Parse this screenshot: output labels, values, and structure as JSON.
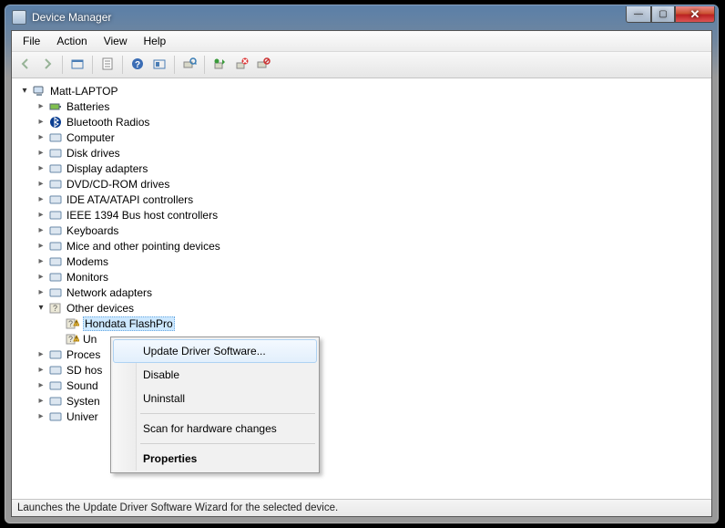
{
  "window": {
    "title": "Device Manager"
  },
  "menubar": [
    "File",
    "Action",
    "View",
    "Help"
  ],
  "toolbar_buttons": [
    {
      "name": "back",
      "enabled": false
    },
    {
      "name": "forward",
      "enabled": false
    },
    {
      "name": "sep"
    },
    {
      "name": "up-container",
      "enabled": true
    },
    {
      "name": "sep"
    },
    {
      "name": "properties-sheet",
      "enabled": true
    },
    {
      "name": "sep"
    },
    {
      "name": "help",
      "enabled": true
    },
    {
      "name": "show-hidden",
      "enabled": true
    },
    {
      "name": "sep"
    },
    {
      "name": "scan-hardware",
      "enabled": true
    },
    {
      "name": "sep"
    },
    {
      "name": "update-driver",
      "enabled": true
    },
    {
      "name": "uninstall",
      "enabled": true
    },
    {
      "name": "disable",
      "enabled": true
    }
  ],
  "tree": {
    "root": "Matt-LAPTOP",
    "children": [
      {
        "label": "Batteries",
        "icon": "battery"
      },
      {
        "label": "Bluetooth Radios",
        "icon": "bluetooth"
      },
      {
        "label": "Computer",
        "icon": "computer"
      },
      {
        "label": "Disk drives",
        "icon": "disk"
      },
      {
        "label": "Display adapters",
        "icon": "display"
      },
      {
        "label": "DVD/CD-ROM drives",
        "icon": "optical"
      },
      {
        "label": "IDE ATA/ATAPI controllers",
        "icon": "ide"
      },
      {
        "label": "IEEE 1394 Bus host controllers",
        "icon": "firewire"
      },
      {
        "label": "Keyboards",
        "icon": "keyboard"
      },
      {
        "label": "Mice and other pointing devices",
        "icon": "mouse"
      },
      {
        "label": "Modems",
        "icon": "modem"
      },
      {
        "label": "Monitors",
        "icon": "monitor"
      },
      {
        "label": "Network adapters",
        "icon": "network"
      },
      {
        "label": "Other devices",
        "icon": "other",
        "expanded": true,
        "children": [
          {
            "label": "Hondata FlashPro",
            "icon": "unknown-warn",
            "selected": true
          },
          {
            "label": "Un",
            "icon": "unknown-warn",
            "truncated": true
          }
        ]
      },
      {
        "label": "Proces",
        "icon": "processor",
        "truncated": true
      },
      {
        "label": "SD hos",
        "icon": "sd",
        "truncated": true
      },
      {
        "label": "Sound",
        "icon": "sound",
        "truncated": true
      },
      {
        "label": "Systen",
        "icon": "system",
        "truncated": true
      },
      {
        "label": "Univer",
        "icon": "usb",
        "truncated": true
      }
    ]
  },
  "context_menu": {
    "items": [
      {
        "label": "Update Driver Software...",
        "hover": true
      },
      {
        "label": "Disable"
      },
      {
        "label": "Uninstall"
      },
      {
        "sep": true
      },
      {
        "label": "Scan for hardware changes"
      },
      {
        "sep": true
      },
      {
        "label": "Properties",
        "bold": true
      }
    ]
  },
  "statusbar": "Launches the Update Driver Software Wizard for the selected device."
}
